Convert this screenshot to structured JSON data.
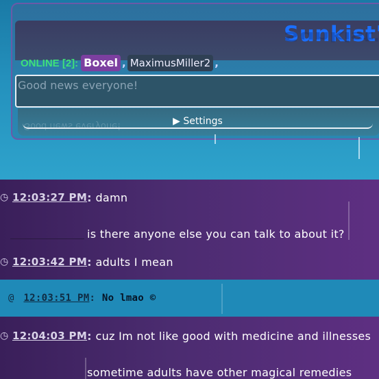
{
  "header": {
    "site_title": "Sunkist's",
    "online_label": "ONLINE [2]:",
    "users": [
      "Boxel",
      "MaximusMiller2"
    ],
    "separator": ","
  },
  "composer": {
    "placeholder": "Good news everyone!",
    "settings_label": "▶ Settings"
  },
  "icons": {
    "timestamp_icon": "clock-icon",
    "at_icon": "at-icon",
    "copyright_icon": "copyright-icon"
  },
  "messages": [
    {
      "time": "12:03:27 PM",
      "lines": [
        "damn",
        "is there anyone else you can talk to about it?"
      ]
    },
    {
      "time": "12:03:42 PM",
      "lines": [
        "adults I mean"
      ]
    },
    {
      "time": "12:03:51 PM",
      "lines": [
        "No lmao ©"
      ]
    },
    {
      "time": "12:04:03 PM",
      "lines": [
        "cuz Im not like good with medicine and illnesses",
        "sometime adults have other magical remedies"
      ]
    }
  ],
  "colors": {
    "title": "#1a6fff",
    "online": "#3fe07a",
    "boxel_badge": "#7c3fa0",
    "purple_row": "#4b2c70",
    "blue_row": "#1f8ab8"
  }
}
